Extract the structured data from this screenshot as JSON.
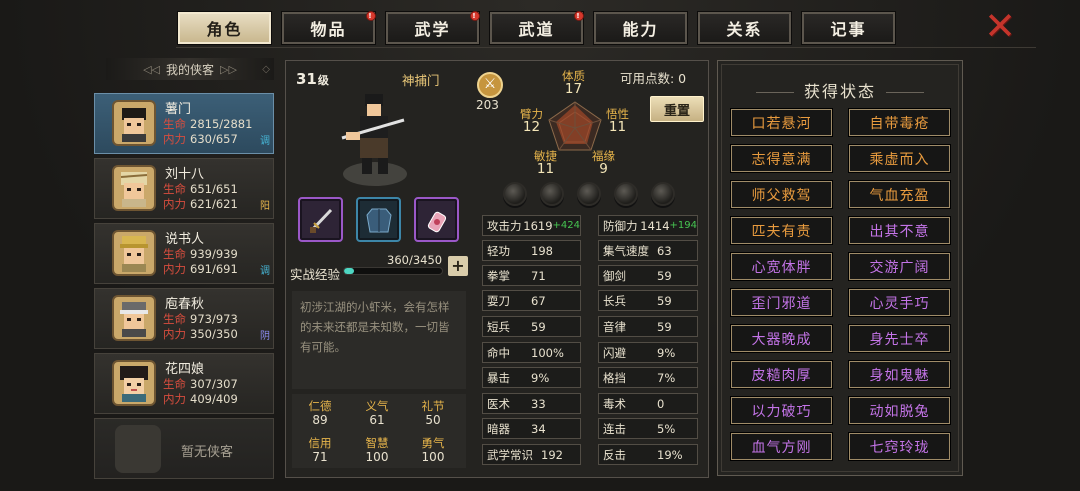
{
  "tabs": [
    {
      "label": "角色",
      "active": true,
      "badge": false
    },
    {
      "label": "物品",
      "active": false,
      "badge": true
    },
    {
      "label": "武学",
      "active": false,
      "badge": true
    },
    {
      "label": "武道",
      "active": false,
      "badge": true
    },
    {
      "label": "能力",
      "active": false,
      "badge": false
    },
    {
      "label": "关系",
      "active": false,
      "badge": false
    },
    {
      "label": "记事",
      "active": false,
      "badge": false
    }
  ],
  "close_icon": "✕",
  "sidebar": {
    "title": "我的侠客",
    "hero_keys": {
      "hp": "生命",
      "mp": "内力"
    },
    "heroes": [
      {
        "name": "薯门",
        "hp": "2815/2881",
        "mp": "630/657",
        "mark": "调",
        "mark_color": "#46b6d6",
        "selected": true
      },
      {
        "name": "刘十八",
        "hp": "651/651",
        "mp": "621/621",
        "mark": "阳",
        "mark_color": "#e7b54b",
        "selected": false
      },
      {
        "name": "说书人",
        "hp": "939/939",
        "mp": "691/691",
        "mark": "调",
        "mark_color": "#46b6d6",
        "selected": false
      },
      {
        "name": "庖春秋",
        "hp": "973/973",
        "mp": "350/350",
        "mark": "阴",
        "mark_color": "#8c8cf2",
        "selected": false
      },
      {
        "name": "花四娘",
        "hp": "307/307",
        "mp": "409/409",
        "mark": "",
        "mark_color": "",
        "selected": false
      }
    ],
    "empty_slot": "暂无侠客"
  },
  "character": {
    "level": "31",
    "level_unit": "级",
    "sect": "神捕门",
    "power": "203",
    "attributes": {
      "tizhi": {
        "label": "体质",
        "value": "17"
      },
      "bili": {
        "label": "臂力",
        "value": "12"
      },
      "wuxing": {
        "label": "悟性",
        "value": "11"
      },
      "minjie": {
        "label": "敏捷",
        "value": "11"
      },
      "fuyuan": {
        "label": "福缘",
        "value": "9"
      }
    },
    "points_label": "可用点数: 0",
    "reset_label": "重置",
    "exp_label": "实战经验",
    "exp_value": "360/3450",
    "exp_fraction": 0.104,
    "description": "初涉江湖的小虾米，会有怎样的未来还都是未知数，一切皆有可能。",
    "virtues": [
      {
        "label": "仁德",
        "value": "89"
      },
      {
        "label": "义气",
        "value": "61"
      },
      {
        "label": "礼节",
        "value": "50"
      },
      {
        "label": "信用",
        "value": "71"
      },
      {
        "label": "智慧",
        "value": "100"
      },
      {
        "label": "勇气",
        "value": "100"
      }
    ],
    "stats_left": [
      {
        "label": "攻击力",
        "value": "1619",
        "bonus": "+424"
      },
      {
        "label": "轻功",
        "value": "198",
        "bonus": ""
      },
      {
        "label": "拳掌",
        "value": "71",
        "bonus": ""
      },
      {
        "label": "耍刀",
        "value": "67",
        "bonus": ""
      },
      {
        "label": "短兵",
        "value": "59",
        "bonus": ""
      },
      {
        "label": "命中",
        "value": "100%",
        "bonus": ""
      },
      {
        "label": "暴击",
        "value": "9%",
        "bonus": ""
      },
      {
        "label": "医术",
        "value": "33",
        "bonus": ""
      },
      {
        "label": "暗器",
        "value": "34",
        "bonus": ""
      },
      {
        "label": "武学常识",
        "value": "192",
        "bonus": ""
      }
    ],
    "stats_right": [
      {
        "label": "防御力",
        "value": "1414",
        "bonus": "+194"
      },
      {
        "label": "集气速度",
        "value": "63",
        "bonus": ""
      },
      {
        "label": "御剑",
        "value": "59",
        "bonus": ""
      },
      {
        "label": "长兵",
        "value": "59",
        "bonus": ""
      },
      {
        "label": "音律",
        "value": "59",
        "bonus": ""
      },
      {
        "label": "闪避",
        "value": "9%",
        "bonus": ""
      },
      {
        "label": "格挡",
        "value": "7%",
        "bonus": ""
      },
      {
        "label": "毒术",
        "value": "0",
        "bonus": ""
      },
      {
        "label": "连击",
        "value": "5%",
        "bonus": ""
      },
      {
        "label": "反击",
        "value": "19%",
        "bonus": ""
      }
    ]
  },
  "status_panel": {
    "title": "获得状态",
    "items": [
      {
        "label": "口若悬河",
        "color": "orange"
      },
      {
        "label": "自带毒疮",
        "color": "orange"
      },
      {
        "label": "志得意满",
        "color": "orange"
      },
      {
        "label": "乘虚而入",
        "color": "orange"
      },
      {
        "label": "师父救驾",
        "color": "orange"
      },
      {
        "label": "气血充盈",
        "color": "orange"
      },
      {
        "label": "匹夫有责",
        "color": "orange"
      },
      {
        "label": "出其不意",
        "color": "purple"
      },
      {
        "label": "心宽体胖",
        "color": "purple"
      },
      {
        "label": "交游广阔",
        "color": "purple"
      },
      {
        "label": "歪门邪道",
        "color": "purple"
      },
      {
        "label": "心灵手巧",
        "color": "purple"
      },
      {
        "label": "大器晚成",
        "color": "purple"
      },
      {
        "label": "身先士卒",
        "color": "purple"
      },
      {
        "label": "皮糙肉厚",
        "color": "purple"
      },
      {
        "label": "身如鬼魅",
        "color": "purple"
      },
      {
        "label": "以力破巧",
        "color": "purple"
      },
      {
        "label": "动如脱兔",
        "color": "purple"
      },
      {
        "label": "血气方刚",
        "color": "purple"
      },
      {
        "label": "七窍玲珑",
        "color": "purple"
      }
    ]
  }
}
